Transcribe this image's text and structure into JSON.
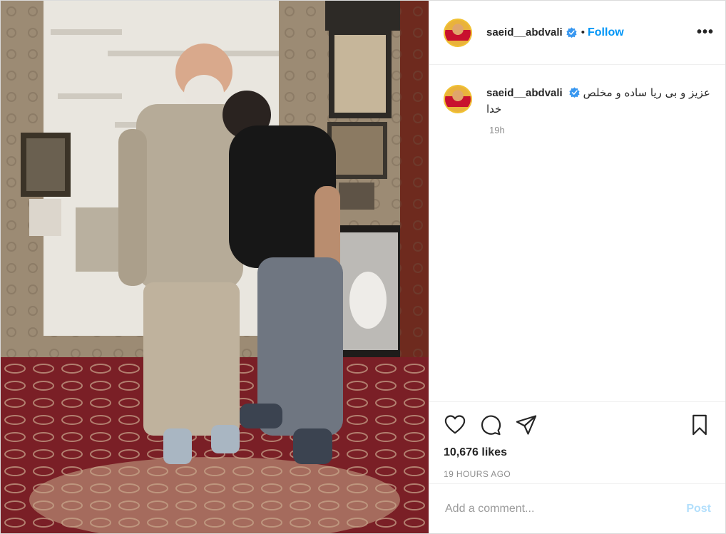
{
  "post": {
    "image_alt": "",
    "author": {
      "username": "saeid__abdvali",
      "verified": true,
      "avatar_icon": "avatar-wrestler"
    },
    "header": {
      "separator": "•",
      "follow_label": "Follow",
      "more_icon": "more-options-icon",
      "more_label": "•••"
    },
    "caption": {
      "username": "saeid__abdvali",
      "text": "عزیز و بی ریا ساده و مخلص خدا",
      "time_ago": "19h"
    },
    "actions": {
      "like_icon": "heart-icon",
      "comment_icon": "comment-icon",
      "share_icon": "share-icon",
      "save_icon": "bookmark-icon"
    },
    "likes_text": "10,676 likes",
    "timestamp_text": "19 HOURS AGO",
    "comment_box": {
      "placeholder": "Add a comment...",
      "value": "",
      "post_label": "Post"
    }
  },
  "colors": {
    "link_blue": "#0095f6",
    "post_disabled": "#b2dffc",
    "muted_text": "#8e8e8e",
    "border": "#dbdbdb",
    "verified_blue": "#3897f0"
  }
}
